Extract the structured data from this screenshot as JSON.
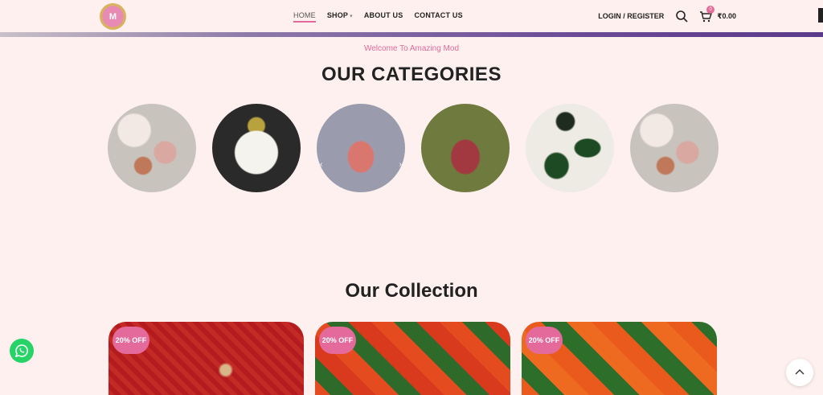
{
  "brand": {
    "logo_text": "M"
  },
  "nav": {
    "items": [
      {
        "label": "HOME",
        "active": true
      },
      {
        "label": "SHOP",
        "has_dropdown": true
      },
      {
        "label": "ABOUT US"
      },
      {
        "label": "CONTACT US"
      }
    ]
  },
  "header": {
    "login_label": "LOGIN / REGISTER",
    "cart_count": "0",
    "cart_total": "₹0.00",
    "search_icon": "search-icon",
    "cart_icon": "cart-icon"
  },
  "categories_section": {
    "welcome_text": "Welcome To Amazing Mod",
    "title": "OUR CATEGORIES",
    "items": [
      {
        "image": "necklace-set"
      },
      {
        "image": "potli-bag"
      },
      {
        "image": "saree-model"
      },
      {
        "image": "tote-bag"
      },
      {
        "image": "green-earrings"
      },
      {
        "image": "necklace-set"
      }
    ],
    "prev_arrow": "‹",
    "next_arrow": "›"
  },
  "collection_section": {
    "title": "Our Collection",
    "products": [
      {
        "badge": "20% OFF",
        "image": "red-bandhani-dupatta"
      },
      {
        "badge": "20% OFF",
        "image": "orange-green-bandhani-dupatta"
      },
      {
        "badge": "20% OFF",
        "image": "orange-green-bandhani-dupatta"
      }
    ]
  },
  "colors": {
    "accent": "#e36a9b",
    "background": "#fdf0ee",
    "whatsapp": "#25d366"
  },
  "floating": {
    "whatsapp_icon": "whatsapp-icon",
    "scroll_top_icon": "chevron-up-icon"
  }
}
